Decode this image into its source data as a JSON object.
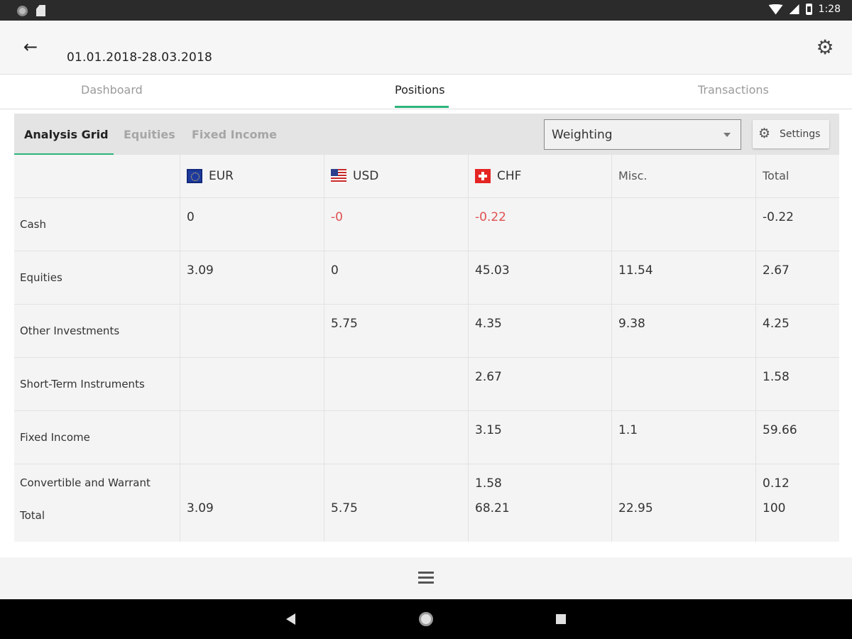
{
  "status_bar": {
    "time": "1:28"
  },
  "header": {
    "date_range": "01.01.2018-28.03.2018"
  },
  "tabs": [
    {
      "label": "Dashboard",
      "active": false
    },
    {
      "label": "Positions",
      "active": true
    },
    {
      "label": "Transactions",
      "active": false
    }
  ],
  "subtabs": [
    {
      "label": "Analysis Grid",
      "active": true
    },
    {
      "label": "Equities",
      "active": false
    },
    {
      "label": "Fixed Income",
      "active": false
    }
  ],
  "view_select": {
    "value": "Weighting"
  },
  "settings_button": {
    "label": "Settings"
  },
  "grid": {
    "columns": [
      "EUR",
      "USD",
      "CHF",
      "Misc.",
      "Total"
    ],
    "rows": [
      {
        "label": "Cash",
        "values": [
          "0",
          "-0",
          "-0.22",
          "",
          "-0.22"
        ]
      },
      {
        "label": "Equities",
        "values": [
          "3.09",
          "0",
          "45.03",
          "11.54",
          "2.67"
        ]
      },
      {
        "label": "Other Investments",
        "values": [
          "",
          "5.75",
          "4.35",
          "9.38",
          "4.25"
        ]
      },
      {
        "label": "Short-Term Instruments",
        "values": [
          "",
          "",
          "2.67",
          "",
          "1.58"
        ]
      },
      {
        "label": "Fixed Income",
        "values": [
          "",
          "",
          "3.15",
          "1.1",
          "59.66"
        ]
      },
      {
        "label": "Convertible and Warrant",
        "values": [
          "",
          "",
          "1.58",
          "",
          "0.12"
        ]
      },
      {
        "label": "Total",
        "values": [
          "3.09",
          "5.75",
          "68.21",
          "22.95",
          "100"
        ]
      }
    ]
  },
  "colors": {
    "accent": "#2db47c",
    "negative": "#e05050"
  }
}
